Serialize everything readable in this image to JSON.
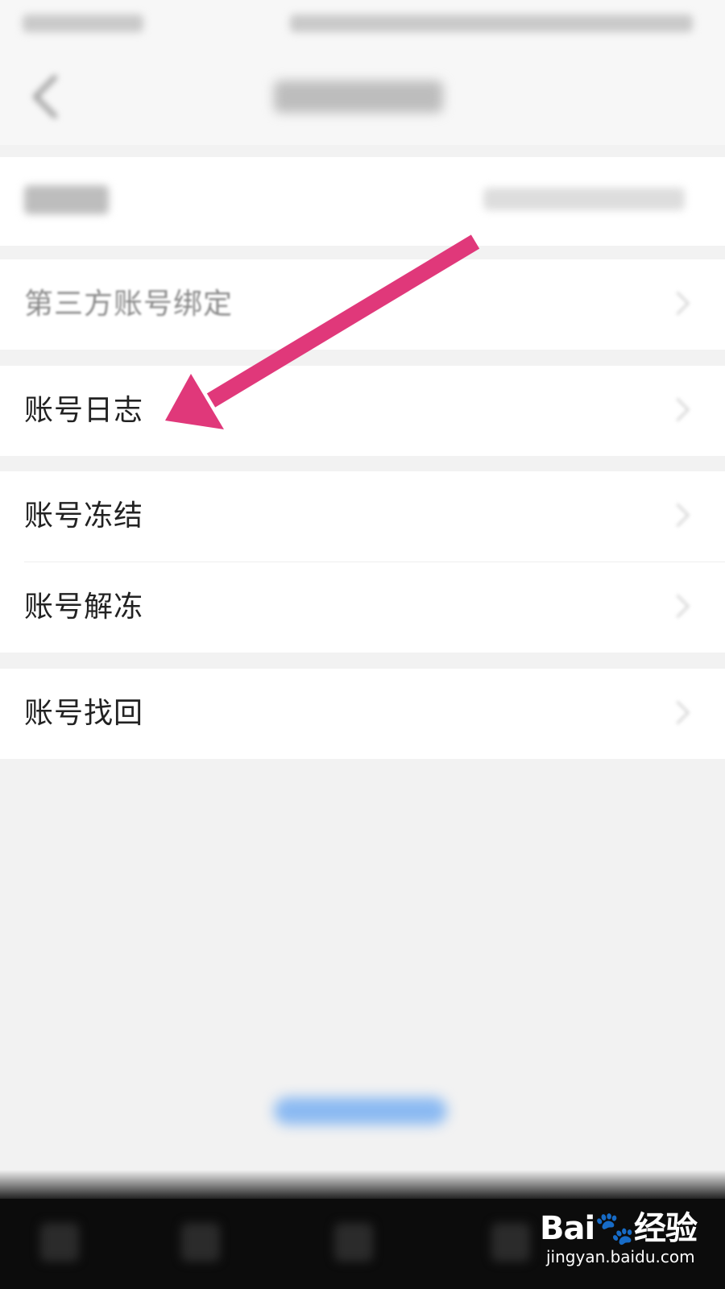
{
  "menu": {
    "items": [
      {
        "label": "第三方账号绑定"
      },
      {
        "label": "账号日志"
      },
      {
        "label": "账号冻结"
      },
      {
        "label": "账号解冻"
      },
      {
        "label": "账号找回"
      }
    ]
  },
  "watermark": {
    "logo": "Bai🐾经验",
    "site": "jingyan.baidu.com"
  },
  "colors": {
    "annotation_arrow": "#e0387a",
    "background": "#f2f2f2",
    "card": "#ffffff"
  },
  "icons": {
    "back": "back-arrow-icon",
    "chevron": "chevron-right-icon"
  }
}
